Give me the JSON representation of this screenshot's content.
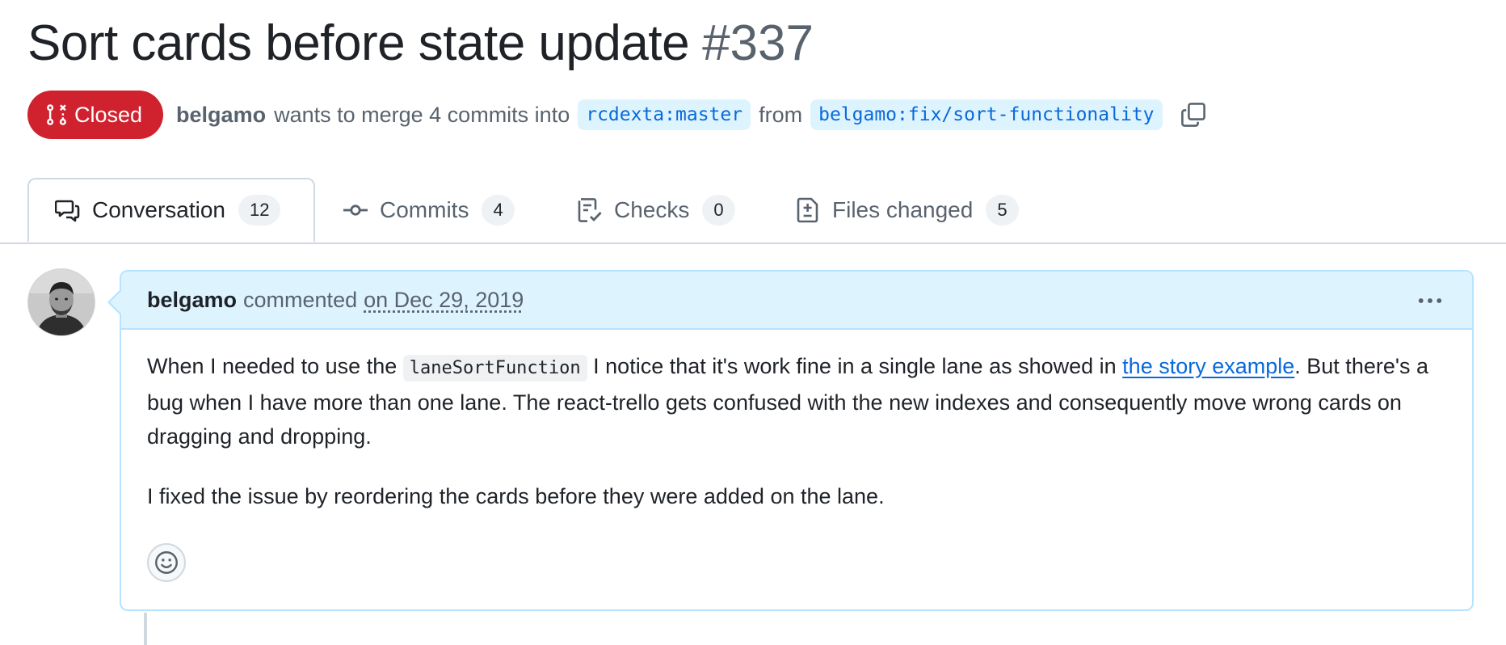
{
  "pr": {
    "title": "Sort cards before state update",
    "number": "#337",
    "state": "Closed",
    "author": "belgamo",
    "merge_text": "wants to merge 4 commits into",
    "base_branch": "rcdexta:master",
    "from_text": "from",
    "head_branch": "belgamo:fix/sort-functionality"
  },
  "tabs": [
    {
      "label": "Conversation",
      "count": "12",
      "icon": "comment-discussion-icon"
    },
    {
      "label": "Commits",
      "count": "4",
      "icon": "git-commit-icon"
    },
    {
      "label": "Checks",
      "count": "0",
      "icon": "checklist-icon"
    },
    {
      "label": "Files changed",
      "count": "5",
      "icon": "file-diff-icon"
    }
  ],
  "comment": {
    "author": "belgamo",
    "action": "commented",
    "date": "on Dec 29, 2019",
    "p1_before": "When I needed to use the ",
    "p1_code": "laneSortFunction",
    "p1_middle": " I notice that it's work fine in a single lane as showed in ",
    "p1_link": "the story example",
    "p1_after": ". But there's a bug when I have more than one lane. The react-trello gets confused with the new indexes and consequently move wrong cards on dragging and dropping.",
    "p2": "I fixed the issue by reordering the cards before they were added on the lane."
  },
  "colors": {
    "closed": "#cf222e",
    "link": "#0969da",
    "header_bg": "#ddf4ff",
    "border_accent": "#b6e3ff"
  }
}
